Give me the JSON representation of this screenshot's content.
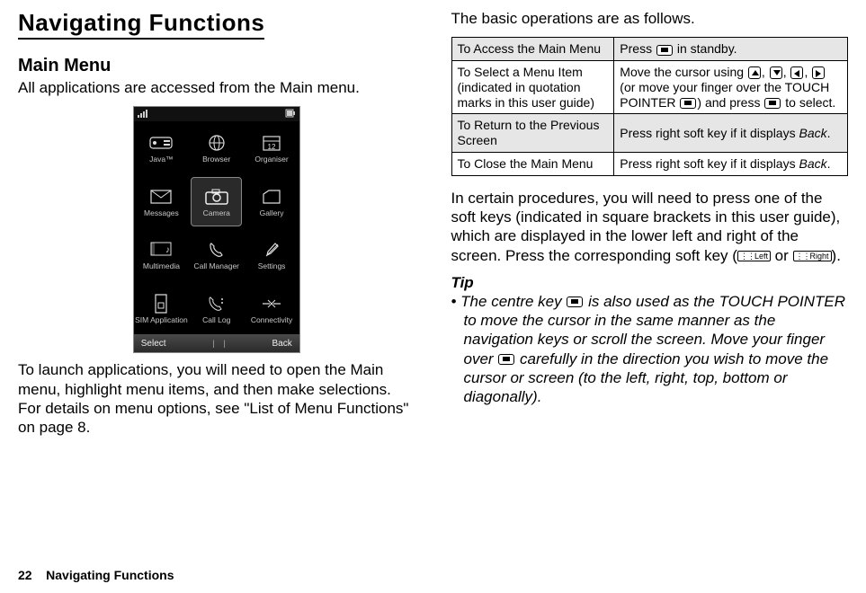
{
  "left": {
    "title": "Navigating Functions",
    "heading": "Main Menu",
    "p1": "All applications are accessed from the Main menu.",
    "p2": "To launch applications, you will need to open the Main menu, highlight menu items, and then make selections. For details on menu options, see \"List of Menu Functions\" on page 8."
  },
  "phone": {
    "apps": {
      "r0c0": "Java™",
      "r0c1": "Browser",
      "r0c2": "Organiser",
      "r1c0": "Messages",
      "r1c1": "Camera",
      "r1c2": "Gallery",
      "r2c0": "Multimedia",
      "r2c1": "Call Manager",
      "r2c2": "Settings",
      "r3c0": "SIM Application",
      "r3c1": "Call Log",
      "r3c2": "Connectivity"
    },
    "soft_left": "Select",
    "soft_right": "Back"
  },
  "right": {
    "intro": "The basic operations are as follows.",
    "table": {
      "r0c0": "To Access the Main Menu",
      "r0c1a": "Press ",
      "r0c1b": " in standby.",
      "r1c0": "To Select a Menu Item (indicated in quotation marks in this user guide)",
      "r1c1a": "Move the cursor using ",
      "r1c1b": " (or move your finger over the TOUCH POINTER ",
      "r1c1c": ") and press ",
      "r1c1d": " to select.",
      "r2c0": "To Return to the Previous Screen",
      "r2c1a": "Press right soft key if it displays ",
      "r2c1b": ".",
      "r3c0": "To Close the Main Menu",
      "r3c1a": "Press right soft key if it displays ",
      "r3c1b": ".",
      "back_word": "Back"
    },
    "p_after_a": "In certain procedures, you will need to press one of the soft keys (indicated in square brackets in this user guide), which are displayed in the lower left and right of the screen. Press the corresponding soft key (",
    "p_after_or": " or ",
    "p_after_b": ").",
    "tip_label": "Tip",
    "tip_a": "•  The centre key ",
    "tip_b": " is also used as the TOUCH POINTER to move the cursor in the same manner as the navigation keys or scroll the screen. Move your finger over ",
    "tip_c": " carefully in the direction you wish to move the cursor or screen (to the left, right, top, bottom or diagonally).",
    "softkey_left_label": "Left",
    "softkey_right_label": "Right"
  },
  "footer": {
    "page": "22",
    "title": "Navigating Functions"
  }
}
